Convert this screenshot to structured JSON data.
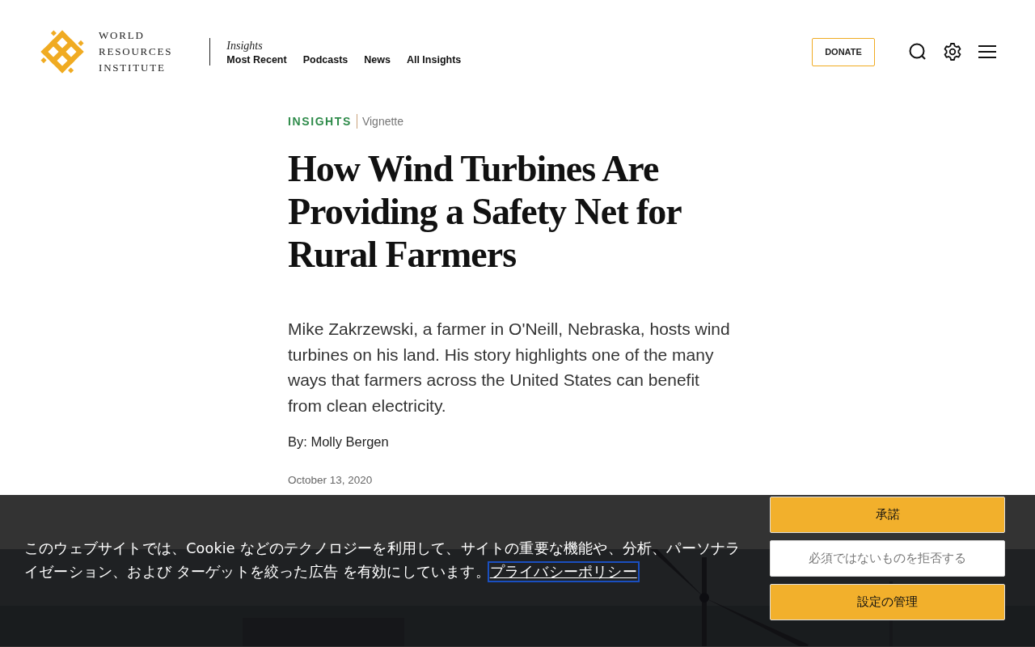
{
  "header": {
    "logo_lines": [
      "WORLD",
      "RESOURCES",
      "INSTITUTE"
    ],
    "section_label": "Insights",
    "nav": [
      "Most Recent",
      "Podcasts",
      "News",
      "All Insights"
    ],
    "donate": "DONATE"
  },
  "article": {
    "category": "INSIGHTS",
    "type": "Vignette",
    "title": "How Wind Turbines Are Providing a Safety Net for Rural Farmers",
    "summary": "Mike Zakrzewski, a farmer in O'Neill, Nebraska, hosts wind turbines on his land. His story highlights one of the many ways that farmers across the United States can benefit from clean electricity.",
    "byline": "By: Molly Bergen",
    "date": "October 13, 2020"
  },
  "cookie_banner": {
    "text": "このウェブサイトでは、Cookie などのテクノロジーを利用して、サイトの重要な機能や、分析、パーソナライゼーション、および ターゲットを絞った広告 を有効にしています。",
    "link": "プライバシーポリシー",
    "buttons": [
      {
        "label": "承諾",
        "kind": "primary"
      },
      {
        "label": "必須ではないものを拒否する",
        "kind": "secondary"
      },
      {
        "label": "設定の管理",
        "kind": "primary"
      }
    ]
  }
}
